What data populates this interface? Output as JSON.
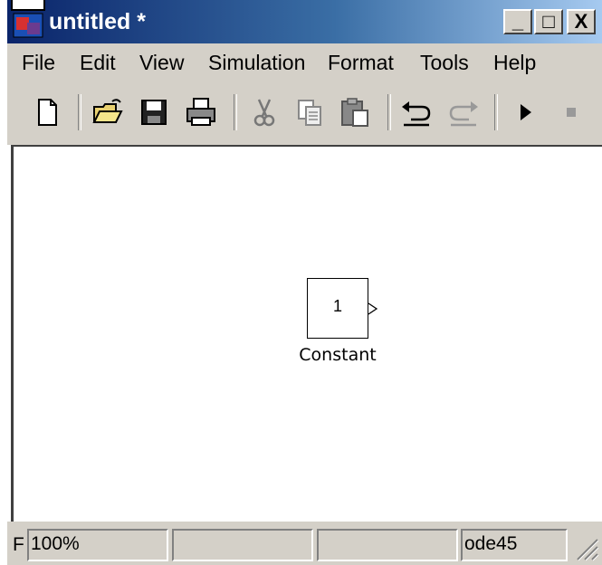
{
  "window": {
    "title": "untitled *",
    "min_label": "_",
    "max_label": "□",
    "close_label": "X"
  },
  "menu": [
    "File",
    "Edit",
    "View",
    "Simulation",
    "Format",
    "Tools",
    "Help"
  ],
  "toolbar": [
    "new-icon",
    "open-icon",
    "save-icon",
    "print-icon",
    "cut-icon",
    "copy-icon",
    "paste-icon",
    "undo-icon",
    "redo-icon",
    "play-icon",
    "stop-icon"
  ],
  "block": {
    "value": "1",
    "label": "Constant"
  },
  "status": {
    "left_char": "F",
    "zoom": "100%",
    "field2": "",
    "field3": "",
    "solver": "ode45"
  }
}
